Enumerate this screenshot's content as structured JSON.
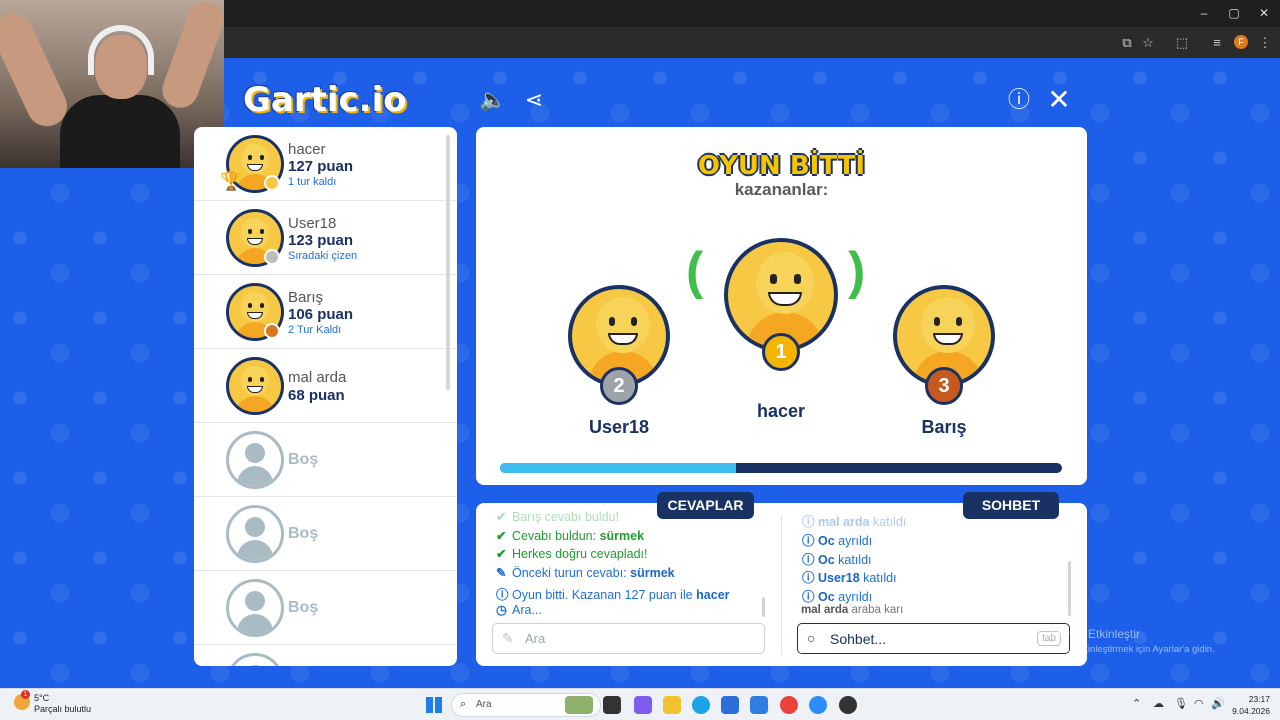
{
  "browser": {
    "window_controls": [
      "–",
      "▢",
      "✕"
    ],
    "profile_initial": "F"
  },
  "header": {
    "logo": "Gartic.io"
  },
  "players": [
    {
      "name": "hacer",
      "points": "127 puan",
      "status": "1 tur kaldı",
      "dot_color": "#f6c843",
      "trophy": true
    },
    {
      "name": "User18",
      "points": "123 puan",
      "status": "Sıradaki çizen",
      "dot_color": "#bdbdbd"
    },
    {
      "name": "Barış",
      "points": "106 puan",
      "status": "2 Tur Kaldı",
      "dot_color": "#d9771e"
    },
    {
      "name": "mal arda",
      "points": "68 puan",
      "status": ""
    }
  ],
  "empty_slots": [
    "Boş",
    "Boş",
    "Boş"
  ],
  "results": {
    "title": "OYUN BİTTİ",
    "subtitle": "kazananlar:",
    "first": {
      "name": "hacer",
      "rank": "1"
    },
    "second": {
      "name": "User18",
      "rank": "2"
    },
    "third": {
      "name": "Barış",
      "rank": "3"
    },
    "progress": 0.42
  },
  "answers_panel": {
    "tab": "CEVAPLAR",
    "messages": [
      {
        "icon": "✔",
        "text": "Barış cevabı buldu!",
        "bold": "",
        "style": "green faded"
      },
      {
        "icon": "✔",
        "text": "Cevabı buldun: ",
        "bold": "sürmek",
        "style": "green"
      },
      {
        "icon": "✔",
        "text": "Herkes doğru cevapladı!",
        "bold": "",
        "style": "green"
      },
      {
        "icon": "✎",
        "text": "Önceki turun cevabı: ",
        "bold": "sürmek",
        "style": ""
      },
      {
        "icon": "ⓘ",
        "text": "Oyun bitti. Kazanan 127 puan ile ",
        "bold": "hacer",
        "style": ""
      },
      {
        "icon": "◷",
        "text": "Ara...",
        "bold": "",
        "style": ""
      }
    ],
    "input_placeholder": "Ara"
  },
  "chat_panel": {
    "tab": "SOHBET",
    "messages": [
      {
        "icon": "ⓘ",
        "bold": "mal arda",
        "text": " katıldı",
        "style": "faded"
      },
      {
        "icon": "ⓘ",
        "bold": "Oc",
        "text": " ayrıldı",
        "style": ""
      },
      {
        "icon": "ⓘ",
        "bold": "Oc",
        "text": " katıldı",
        "style": ""
      },
      {
        "icon": "ⓘ",
        "bold": "User18",
        "text": " katıldı",
        "style": ""
      },
      {
        "icon": "ⓘ",
        "bold": "Oc",
        "text": " ayrıldı",
        "style": ""
      },
      {
        "icon": "",
        "bold": "mal arda",
        "text": " araba karı",
        "style": "gray"
      }
    ],
    "input_placeholder": "Sohbet...",
    "tab_hint": "tab"
  },
  "watermark": {
    "line1": "Windows'u Etkinleştir",
    "line2": "Windows'u etkinleştirmek için Ayarlar'a gidin."
  },
  "taskbar": {
    "weather_temp": "5°C",
    "weather_desc": "Parçalı bulutlu",
    "weather_badge": "1",
    "search_placeholder": "Ara",
    "time": "23:17",
    "date": "9.04.2026"
  }
}
